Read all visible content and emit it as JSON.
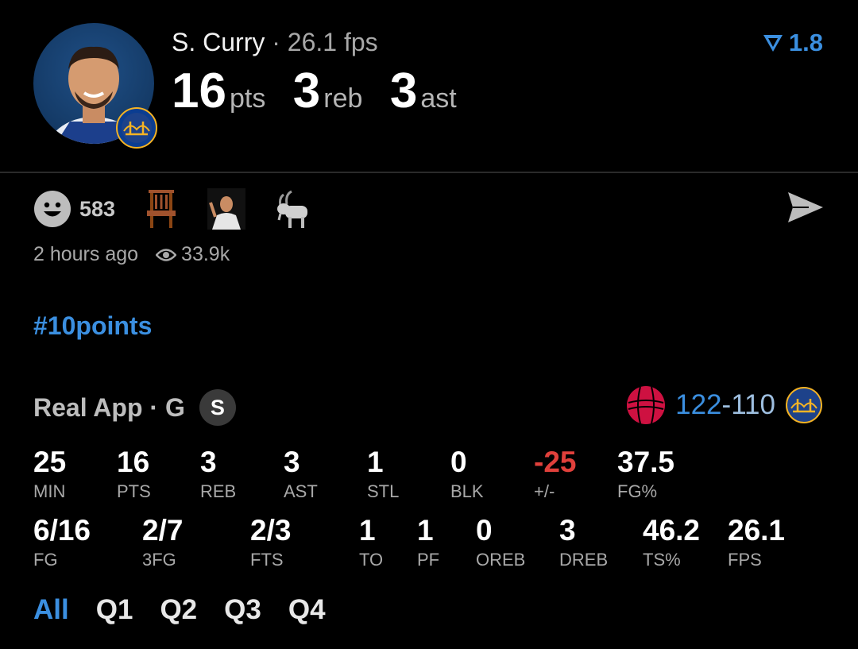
{
  "player": {
    "name": "S. Curry",
    "fps_label": "26.1 fps",
    "separator": "·",
    "pts": "16",
    "pts_unit": "pts",
    "reb": "3",
    "reb_unit": "reb",
    "ast": "3",
    "ast_unit": "ast",
    "badge_value": "1.8"
  },
  "reactions": {
    "count": "583",
    "icons": [
      "smiley-icon",
      "chair-icon",
      "player-reaction-icon",
      "goat-icon"
    ],
    "time_ago": "2 hours ago",
    "views": "33.9k"
  },
  "hashtag": "#10points",
  "game": {
    "source": "Real App · G",
    "source_badge": "S",
    "score_home": "122",
    "score_dash": "-",
    "score_away": "110"
  },
  "stats_row1": [
    {
      "value": "25",
      "label": "MIN"
    },
    {
      "value": "16",
      "label": "PTS"
    },
    {
      "value": "3",
      "label": "REB"
    },
    {
      "value": "3",
      "label": "AST"
    },
    {
      "value": "1",
      "label": "STL"
    },
    {
      "value": "0",
      "label": "BLK"
    },
    {
      "value": "-25",
      "label": "+/-"
    },
    {
      "value": "37.5",
      "label": "FG%"
    }
  ],
  "stats_row2": [
    {
      "value": "6/16",
      "label": "FG"
    },
    {
      "value": "2/7",
      "label": "3FG"
    },
    {
      "value": "2/3",
      "label": "FTS"
    },
    {
      "value": "1",
      "label": "TO"
    },
    {
      "value": "1",
      "label": "PF"
    },
    {
      "value": "0",
      "label": "OREB"
    },
    {
      "value": "3",
      "label": "DREB"
    },
    {
      "value": "46.2",
      "label": "TS%"
    },
    {
      "value": "26.1",
      "label": "FPS"
    }
  ],
  "tabs": [
    "All",
    "Q1",
    "Q2",
    "Q3",
    "Q4"
  ],
  "colors": {
    "accent": "#3b8fe0",
    "negative": "#e0403b",
    "background": "#000000"
  }
}
